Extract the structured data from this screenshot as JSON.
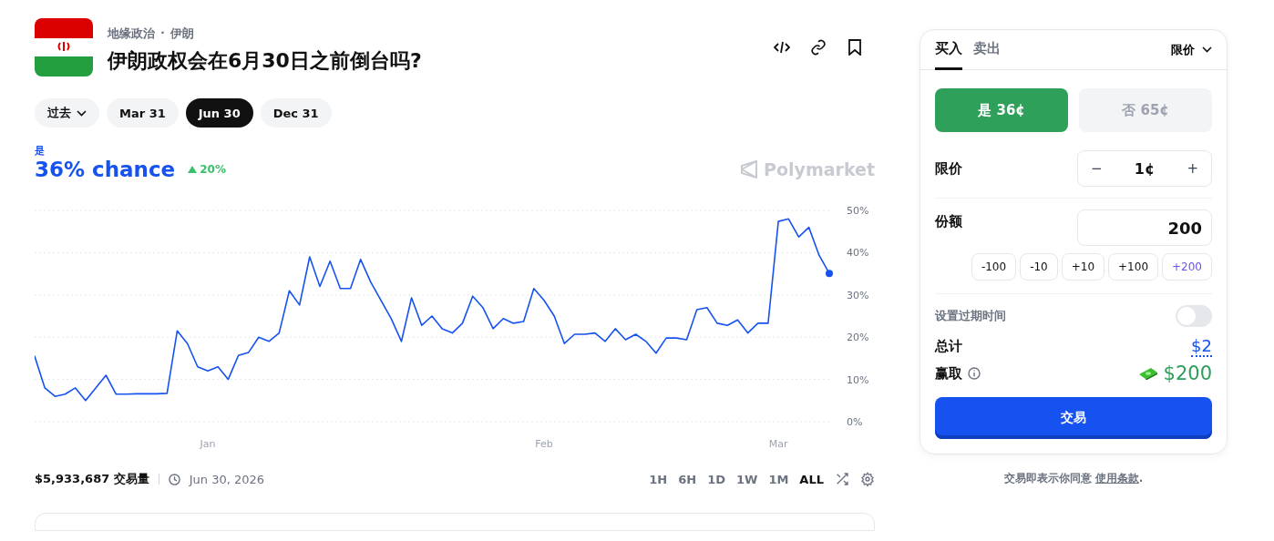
{
  "header": {
    "breadcrumb": [
      "地缘政治",
      "伊朗"
    ],
    "breadcrumb_separator": "·",
    "title": "伊朗政权会在6月30日之前倒台吗?"
  },
  "date_filters": [
    {
      "label": "过去",
      "kind": "dropdown",
      "selected": false
    },
    {
      "label": "Mar 31",
      "kind": "pill",
      "selected": false
    },
    {
      "label": "Jun 30",
      "kind": "pill",
      "selected": true
    },
    {
      "label": "Dec 31",
      "kind": "pill",
      "selected": false
    }
  ],
  "summary": {
    "chance": "36% chance",
    "change": "20%",
    "brand": "Polymarket"
  },
  "chart_data": {
    "type": "line",
    "grid": true,
    "ylim": [
      0,
      50
    ],
    "categories": [
      null,
      null,
      null,
      null,
      null,
      null,
      null,
      null,
      null,
      null,
      null,
      null,
      null,
      null,
      null,
      null,
      null,
      "Jan",
      null,
      null,
      null,
      null,
      null,
      null,
      null,
      null,
      null,
      null,
      null,
      null,
      null,
      null,
      null,
      null,
      null,
      null,
      null,
      null,
      null,
      null,
      null,
      null,
      null,
      null,
      null,
      null,
      null,
      null,
      null,
      null,
      "Feb",
      null,
      null,
      null,
      null,
      null,
      null,
      null,
      null,
      null,
      null,
      null,
      null,
      null,
      null,
      null,
      null,
      null,
      null,
      null,
      null,
      null,
      null,
      "Mar",
      null,
      null,
      null,
      null,
      null
    ],
    "yticks": [
      {
        "value": 0,
        "label": "0%"
      },
      {
        "value": 10,
        "label": "10%"
      },
      {
        "value": 20,
        "label": "20%"
      },
      {
        "value": 30,
        "label": "30%"
      },
      {
        "value": 40,
        "label": "40%"
      },
      {
        "value": 50,
        "label": "50%"
      }
    ],
    "series": [
      {
        "name": "是",
        "color": "#1652f0",
        "values": [
          15.5,
          8,
          6,
          6.5,
          8,
          5,
          8,
          11,
          6.5,
          6.5,
          6.6,
          6.6,
          6.6,
          6.7,
          21.5,
          18.5,
          13,
          12,
          13,
          10,
          15.7,
          16.4,
          20,
          19,
          21,
          31,
          27.6,
          39,
          32,
          38,
          31.5,
          31.5,
          38.4,
          33,
          28.7,
          24.4,
          19,
          29.3,
          22.8,
          25,
          22,
          21,
          23.3,
          29.7,
          27,
          22,
          24.4,
          23.3,
          23.7,
          31.5,
          28.7,
          25,
          18.5,
          20.7,
          20.7,
          21,
          19,
          22,
          19.4,
          20.7,
          19,
          16.2,
          19.8,
          19.8,
          19.4,
          26.5,
          27,
          23.3,
          22.8,
          24.1,
          21,
          23.3,
          23.3,
          47.4,
          48,
          43.7,
          46,
          39.4,
          35.1
        ]
      }
    ]
  },
  "footer": {
    "volume": "$5,933,687 交易量",
    "end_date": "Jun 30, 2026"
  },
  "time_ranges": [
    {
      "label": "1H",
      "selected": false
    },
    {
      "label": "6H",
      "selected": false
    },
    {
      "label": "1D",
      "selected": false
    },
    {
      "label": "1W",
      "selected": false
    },
    {
      "label": "1M",
      "selected": false
    },
    {
      "label": "ALL",
      "selected": true
    }
  ],
  "trade_panel": {
    "tabs": [
      {
        "label": "买入",
        "selected": true
      },
      {
        "label": "卖出",
        "selected": false
      }
    ],
    "order_type": "限价",
    "outcomes": [
      {
        "label": "是 36¢",
        "kind": "yes",
        "selected": true
      },
      {
        "label": "否 65¢",
        "kind": "no",
        "selected": false
      }
    ],
    "limit_price": {
      "label": "限价",
      "minus": "−",
      "value": "1¢",
      "plus": "+"
    },
    "shares": {
      "label": "份额",
      "value": "200"
    },
    "chips": [
      {
        "label": "-100",
        "accent": false
      },
      {
        "label": "-10",
        "accent": false
      },
      {
        "label": "+10",
        "accent": false
      },
      {
        "label": "+100",
        "accent": false
      },
      {
        "label": "+200",
        "accent": true
      }
    ],
    "expiration": {
      "label": "设置过期时间",
      "on": false
    },
    "total": {
      "label": "总计",
      "value": "$2"
    },
    "to_win": {
      "label": "赢取",
      "value": "$200"
    },
    "submit": "交易"
  },
  "terms": {
    "text": "交易即表示你同意",
    "link": "使用条款",
    "end": "."
  }
}
